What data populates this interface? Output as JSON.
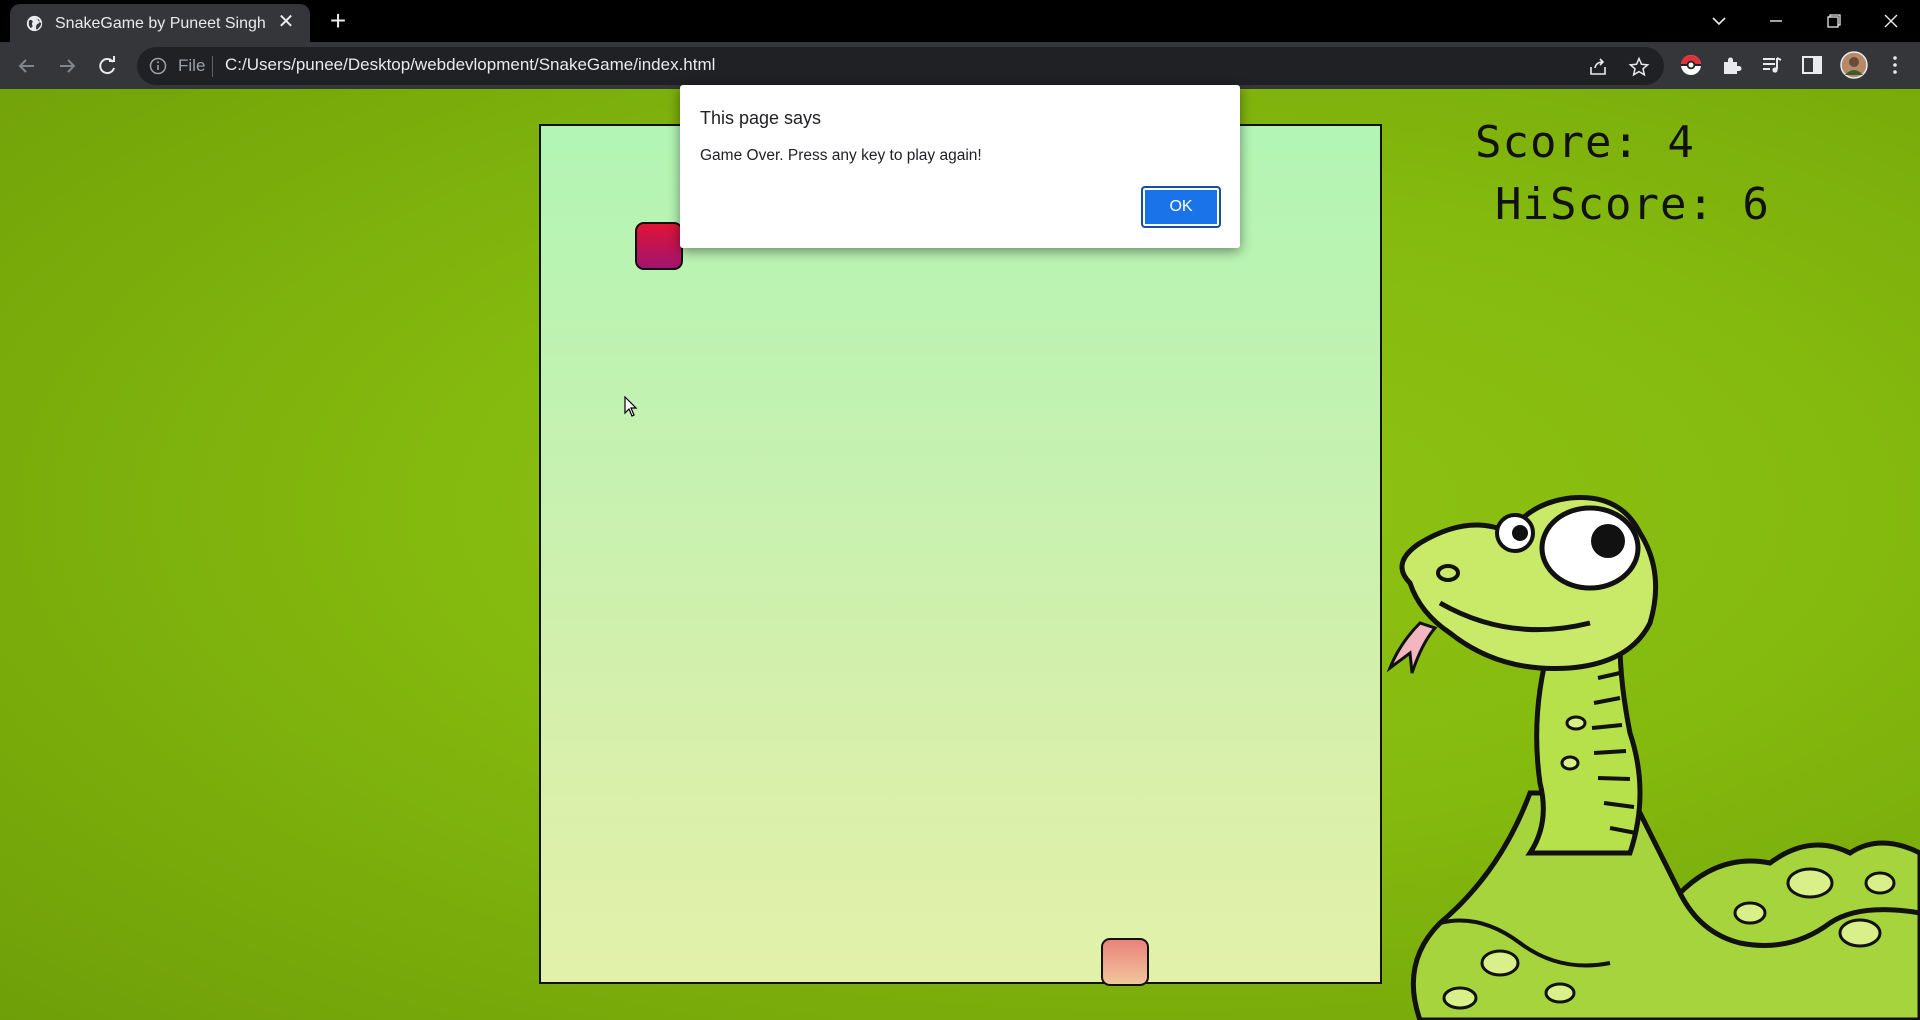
{
  "browser": {
    "tab_title": "SnakeGame by Puneet Singh",
    "tab_close": "✕",
    "new_tab": "+",
    "scheme_label": "File",
    "url": "C:/Users/punee/Desktop/webdevlopment/SnakeGame/index.html"
  },
  "game": {
    "score_text": "Score: 4",
    "hiscore_text": "HiScore: 6",
    "food_color": "#e11436",
    "snake_head_color": "#e9827c",
    "background_color": "#84b90e"
  },
  "dialog": {
    "title": "This page says",
    "message": "Game Over. Press any key to play again!",
    "ok_label": "OK"
  }
}
